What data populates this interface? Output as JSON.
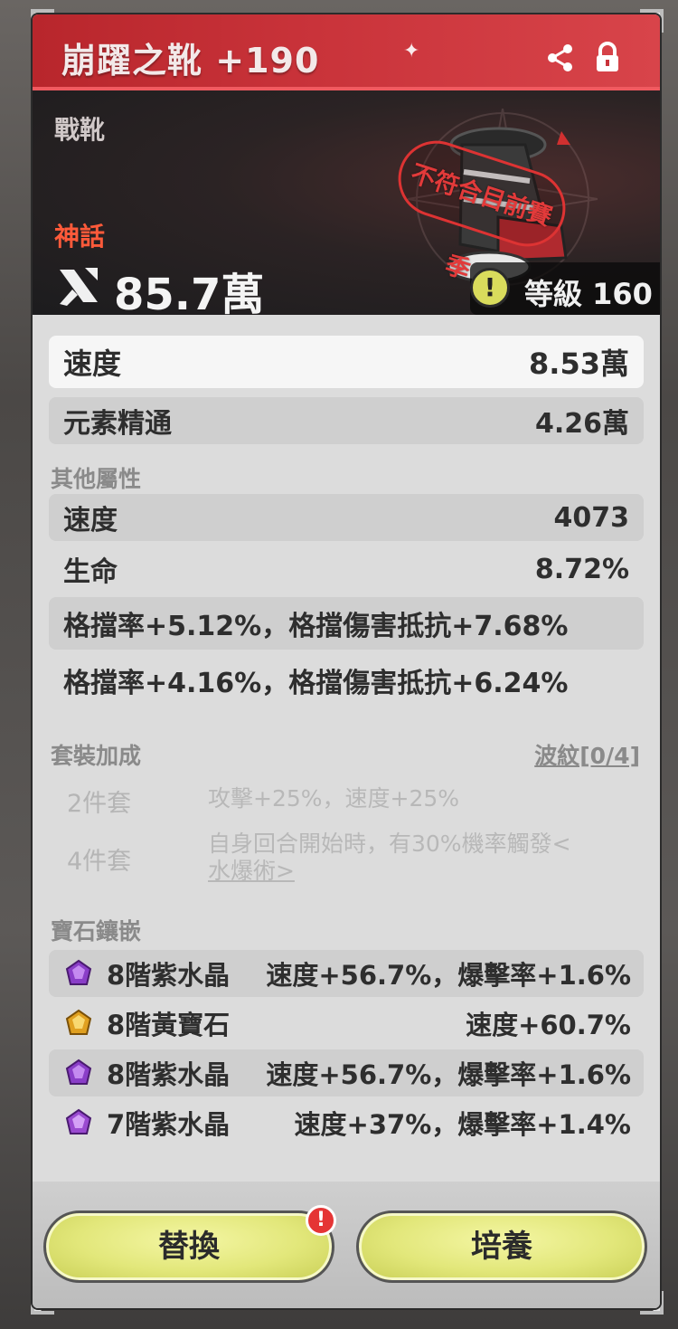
{
  "header": {
    "title": "崩躍之靴 +190",
    "share_icon": "share-icon",
    "lock_icon": "lock-icon"
  },
  "hero": {
    "slot": "戰靴",
    "rarity": "神話",
    "power": "85.7萬",
    "stamp": "不符合目前賽季",
    "level": "等級 160",
    "warning_icon": "warning-icon",
    "rarity_color": "#ff5a3a"
  },
  "main_stats": [
    {
      "label": "速度",
      "value": "8.53萬"
    },
    {
      "label": "元素精通",
      "value": "4.26萬"
    }
  ],
  "other_stats": {
    "title": "其他屬性",
    "rows": [
      {
        "label": "速度",
        "value": "4073"
      },
      {
        "label": "生命",
        "value": "8.72%"
      },
      {
        "label": "格擋率+5.12%，格擋傷害抵抗+7.68%",
        "value": ""
      },
      {
        "label": "格擋率+4.16%，格擋傷害抵抗+6.24%",
        "value": ""
      }
    ]
  },
  "set_bonus": {
    "title": "套裝加成",
    "set_name": "波紋[0/4]",
    "tiers": [
      {
        "pieces": "2件套",
        "desc": "攻擊+25%，速度+25%"
      },
      {
        "pieces": "4件套",
        "desc_a": "自身回合開始時，有30%機率觸發<",
        "desc_b": "水爆術>"
      }
    ]
  },
  "gems": {
    "title": "寶石鑲嵌",
    "items": [
      {
        "name": "8階紫水晶",
        "value": "速度+56.7%，爆擊率+1.6%",
        "color": "#8a3ec8"
      },
      {
        "name": "8階黃寶石",
        "value": "速度+60.7%",
        "color": "#e0a020"
      },
      {
        "name": "8階紫水晶",
        "value": "速度+56.7%，爆擊率+1.6%",
        "color": "#8a3ec8"
      },
      {
        "name": "7階紫水晶",
        "value": "速度+37%，爆擊率+1.4%",
        "color": "#9a4ad0"
      }
    ]
  },
  "buttons": {
    "replace": "替換",
    "cultivate": "培養",
    "alert": "!"
  }
}
